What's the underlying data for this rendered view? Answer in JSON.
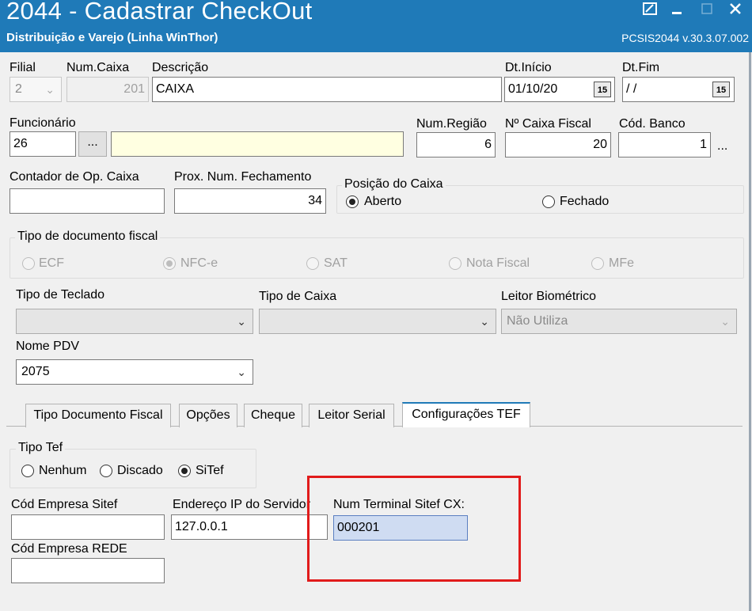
{
  "window": {
    "title": "2044 - Cadastrar CheckOut",
    "subtitle": "Distribuição e Varejo (Linha WinThor)",
    "version": "PCSIS2044  v.30.3.07.002"
  },
  "fields": {
    "filial": {
      "label": "Filial",
      "value": "2"
    },
    "num_caixa": {
      "label": "Num.Caixa",
      "value": "201"
    },
    "descricao": {
      "label": "Descrição",
      "value": "CAIXA"
    },
    "dt_inicio": {
      "label": "Dt.Início",
      "value": "01/10/20",
      "cal": "15"
    },
    "dt_fim": {
      "label": "Dt.Fim",
      "value": " / /",
      "cal": "15"
    },
    "funcionario": {
      "label": "Funcionário",
      "value": "26",
      "button": "...",
      "name": ""
    },
    "num_regiao": {
      "label": "Num.Região",
      "value": "6"
    },
    "num_caixa_fiscal": {
      "label": "Nº Caixa Fiscal",
      "value": "20"
    },
    "cod_banco": {
      "label": "Cód. Banco",
      "value": "1",
      "ellipsis": "..."
    },
    "contador_op": {
      "label": "Contador de Op. Caixa",
      "value": ""
    },
    "prox_num_fech": {
      "label": "Prox. Num. Fechamento",
      "value": "34"
    }
  },
  "posicao_caixa": {
    "title": "Posição do Caixa",
    "options": [
      {
        "label": "Aberto",
        "selected": true
      },
      {
        "label": "Fechado",
        "selected": false
      }
    ]
  },
  "tipo_doc_fiscal": {
    "title": "Tipo de documento fiscal",
    "options": [
      {
        "label": "ECF",
        "selected": false
      },
      {
        "label": "NFC-e",
        "selected": true
      },
      {
        "label": "SAT",
        "selected": false
      },
      {
        "label": "Nota Fiscal",
        "selected": false
      },
      {
        "label": "MFe",
        "selected": false
      }
    ]
  },
  "combos": {
    "tipo_teclado": {
      "label": "Tipo de Teclado",
      "value": ""
    },
    "tipo_caixa": {
      "label": "Tipo de Caixa",
      "value": ""
    },
    "leitor_biometrico": {
      "label": "Leitor Biométrico",
      "value": "Não Utiliza"
    },
    "nome_pdv": {
      "label": "Nome PDV",
      "value": "2075"
    }
  },
  "tabs": [
    {
      "label": "Tipo Documento Fiscal",
      "active": false
    },
    {
      "label": "Opções",
      "active": false
    },
    {
      "label": "Cheque",
      "active": false
    },
    {
      "label": "Leitor Serial",
      "active": false
    },
    {
      "label": "Configurações TEF",
      "active": true
    }
  ],
  "tef": {
    "tipo_tef": {
      "title": "Tipo Tef",
      "options": [
        {
          "label": "Nenhum",
          "selected": false
        },
        {
          "label": "Discado",
          "selected": false
        },
        {
          "label": "SiTef",
          "selected": true
        }
      ]
    },
    "cod_empresa_sitef": {
      "label": "Cód Empresa Sitef",
      "value": ""
    },
    "endereco_ip": {
      "label": "Endereço IP do Servidor",
      "value": "127.0.0.1"
    },
    "num_terminal": {
      "label": "Num Terminal Sitef CX:",
      "value": "000201"
    },
    "cod_empresa_rede": {
      "label": "Cód Empresa REDE",
      "value": ""
    }
  },
  "colors": {
    "titlebar": "#1f7ab8",
    "highlight": "#e11b1b",
    "selection": "#cfdcf2"
  }
}
